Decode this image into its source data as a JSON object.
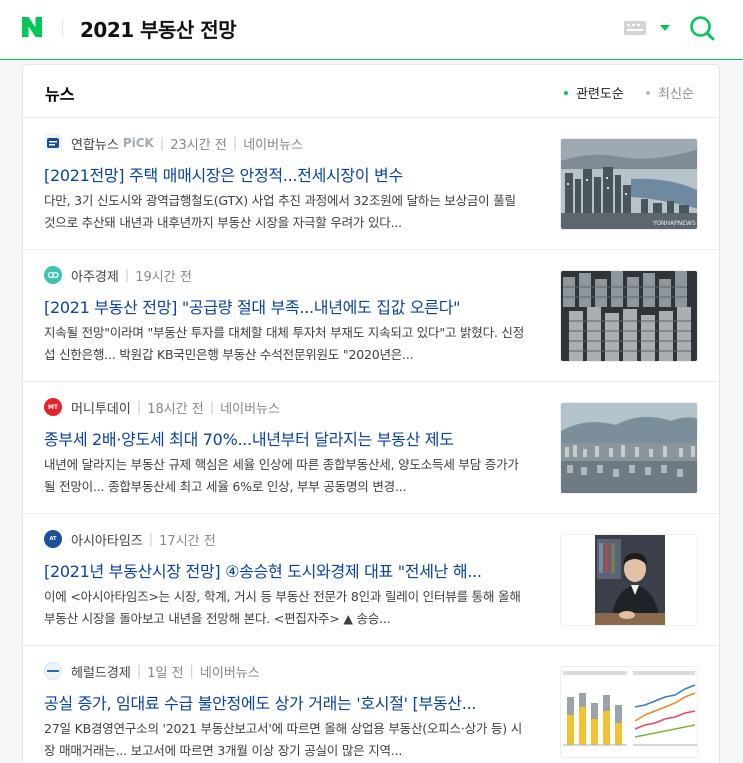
{
  "header": {
    "logo_letter": "N",
    "query": "2021 부동산 전망"
  },
  "section": {
    "title": "뉴스",
    "sort_relevance": "관련도순",
    "sort_latest": "최신순"
  },
  "colors": {
    "brand_green": "#03c75a",
    "title_blue": "#0b42a6"
  },
  "news": [
    {
      "press": "연합뉴스",
      "pick": "PiCK",
      "time": "23시간 전",
      "naver": "네이버뉴스",
      "title": "[2021전망] 주택 매매시장은 안정적...전세시장이 변수",
      "desc": "다만, 3기 신도시와 광역급행철도(GTX) 사업 추진 과정에서 32조원에 달하는 보상금이 풀릴 것으로 추산돼 내년과 내후년까지 부동산 시장을 자극할 우려가 있다...",
      "thumb_watermark": "YONHAPNEWS"
    },
    {
      "press": "아주경제",
      "time": "19시간 전",
      "title": "[2021 부동산 전망] \"공급량 절대 부족...내년에도 집값 오른다\"",
      "desc": "지속될 전망\"이라며 \"부동산 투자를 대체할 대체 투자처 부재도 지속되고 있다\"고 밝혔다. 신정섭 신한은행... 박원갑 KB국민은행 부동산 수석전문위원도 \"2020년은..."
    },
    {
      "press": "머니투데이",
      "time": "18시간 전",
      "naver": "네이버뉴스",
      "title": "종부세 2배·양도세 최대 70%...내년부터 달라지는 부동산 제도",
      "desc": "내년에 달라지는 부동산 규제 핵심은 세율 인상에 따른 종합부동산세, 양도소득세 부담 증가가 될 전망이... 종합부동산세 최고 세율 6%로 인상, 부부 공동명의 변경..."
    },
    {
      "press": "아시아타임즈",
      "time": "17시간 전",
      "title": "[2021년 부동산시장 전망] ④송승현 도시와경제 대표 \"전세난 해...",
      "desc": "이에 <아시아타임즈>는 시장, 학계, 거시 등 부동산 전문가 8인과 릴레이 인터뷰를 통해 올해 부동산 시장을 돌아보고 내년을 전망해 본다. <편집자주> ▲ 송승..."
    },
    {
      "press": "헤럴드경제",
      "time": "1일 전",
      "naver": "네이버뉴스",
      "title": "공실 증가, 임대료 수급 불안정에도 상가 거래는 '호시절' [부동산...",
      "desc": "27일 KB경영연구소의 '2021 부동산보고서'에 따르면 올해 상업용 부동산(오피스·상가 등) 시장 매매거래는... 보고서에 따르면 3개월 이상 장기 공실이 많은 지역..."
    }
  ]
}
